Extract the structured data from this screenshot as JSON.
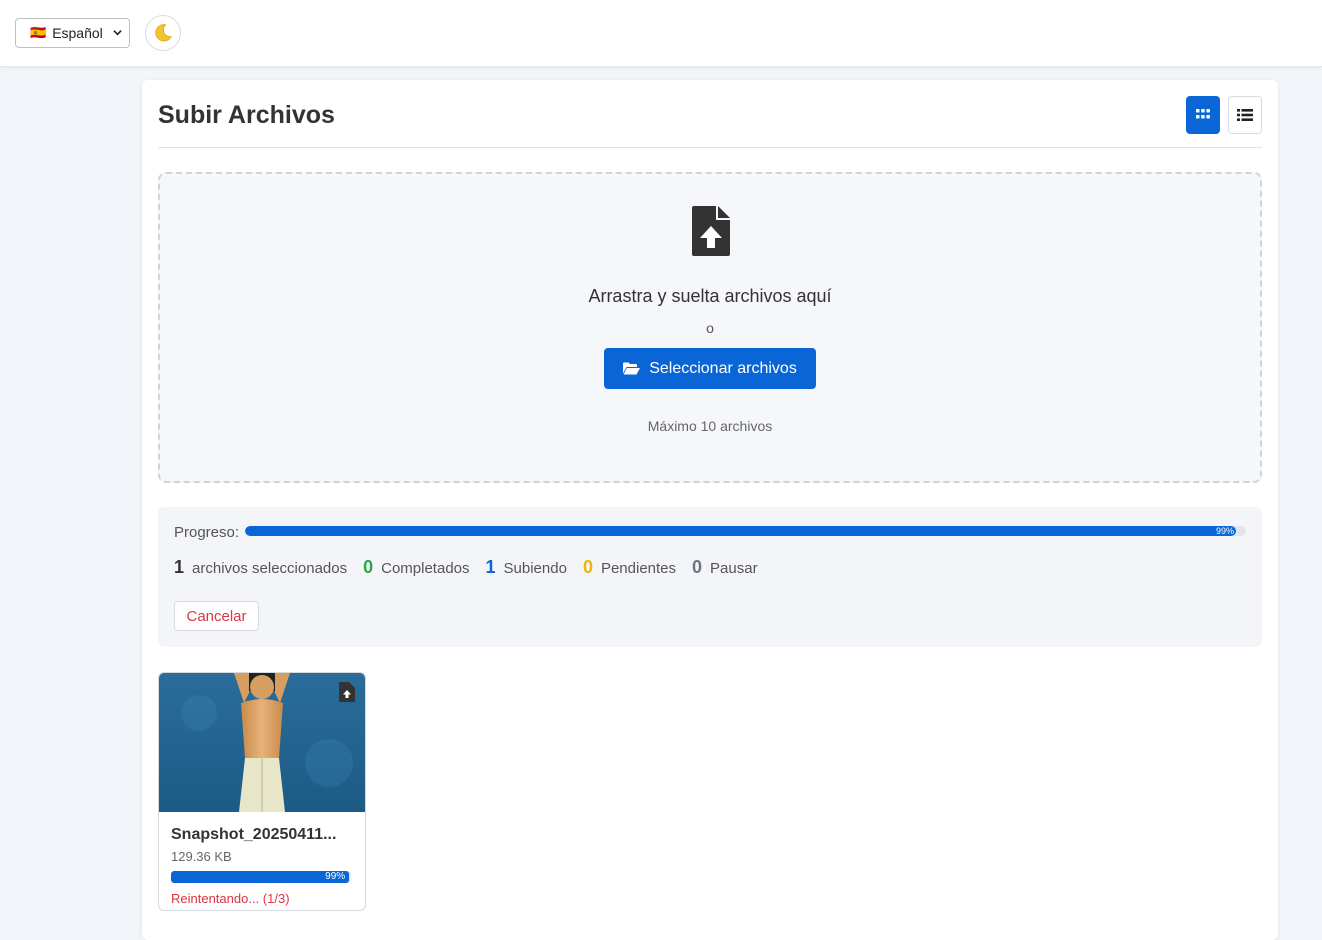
{
  "header": {
    "language": {
      "flag": "🇪🇸",
      "label": "Español"
    },
    "theme_toggle_icon": "moon-icon"
  },
  "upload": {
    "title": "Subir Archivos",
    "view_modes": [
      "grid-icon",
      "list-icon"
    ],
    "active_view": "grid",
    "dropzone": {
      "icon": "file-upload-icon",
      "text": "Arrastra y suelta archivos aquí",
      "or": "o",
      "button_label": "Seleccionar archivos",
      "button_icon": "folder-open-icon",
      "max_text": "Máximo 10 archivos"
    },
    "progress": {
      "label": "Progreso:",
      "value": 99,
      "percent_text": "99%"
    },
    "stats": [
      {
        "count": "1",
        "label": "archivos seleccionados",
        "color": "#333333"
      },
      {
        "count": "0",
        "label": "Completados",
        "color": "#28a745"
      },
      {
        "count": "1",
        "label": "Subiendo",
        "color": "#0a66d6"
      },
      {
        "count": "0",
        "label": "Pendientes",
        "color": "#f0b400"
      },
      {
        "count": "0",
        "label": "Pausar",
        "color": "#6c757d"
      }
    ],
    "cancel_label": "Cancelar",
    "files": [
      {
        "name": "Snapshot_20250411...",
        "size": "129.36 KB",
        "progress": 99,
        "percent_text": "99%",
        "status": "Reintentando... (1/3)"
      }
    ]
  },
  "colors": {
    "accent": "#0a66d6",
    "danger": "#dc3545",
    "success": "#28a745",
    "warning": "#f0b400"
  }
}
